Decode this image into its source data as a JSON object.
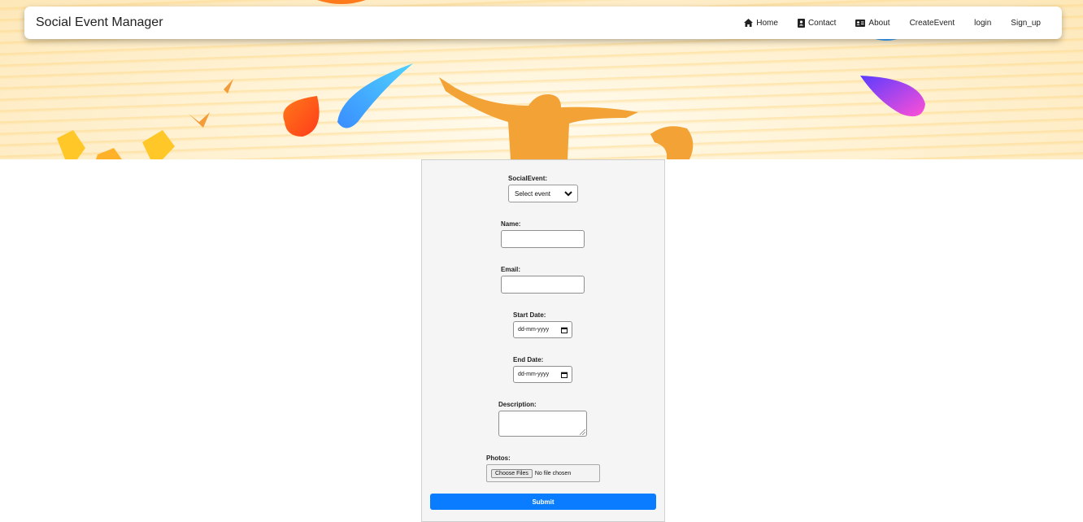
{
  "app": {
    "title": "Social Event Manager"
  },
  "nav": {
    "items": [
      {
        "label": "Home",
        "icon": "home-icon"
      },
      {
        "label": "Contact",
        "icon": "contact-icon"
      },
      {
        "label": "About",
        "icon": "id-card-icon"
      },
      {
        "label": "CreateEvent"
      },
      {
        "label": "login"
      },
      {
        "label": "Sign_up"
      }
    ]
  },
  "form": {
    "social_event": {
      "label": "SocialEvent:",
      "selected": "Select event"
    },
    "name": {
      "label": "Name:",
      "value": ""
    },
    "email": {
      "label": "Email:",
      "value": ""
    },
    "start_date": {
      "label": "Start Date:",
      "placeholder": "dd-mm-yyyy"
    },
    "end_date": {
      "label": "End Date:",
      "placeholder": "dd-mm-yyyy"
    },
    "description": {
      "label": "Description:",
      "value": ""
    },
    "photos": {
      "label": "Photos:",
      "button": "Choose Files",
      "status": "No file chosen"
    },
    "submit_label": "Submit"
  },
  "colors": {
    "primary": "#0a7cff",
    "nav_bg": "#ffffff",
    "card_bg": "#f5f5f5"
  }
}
